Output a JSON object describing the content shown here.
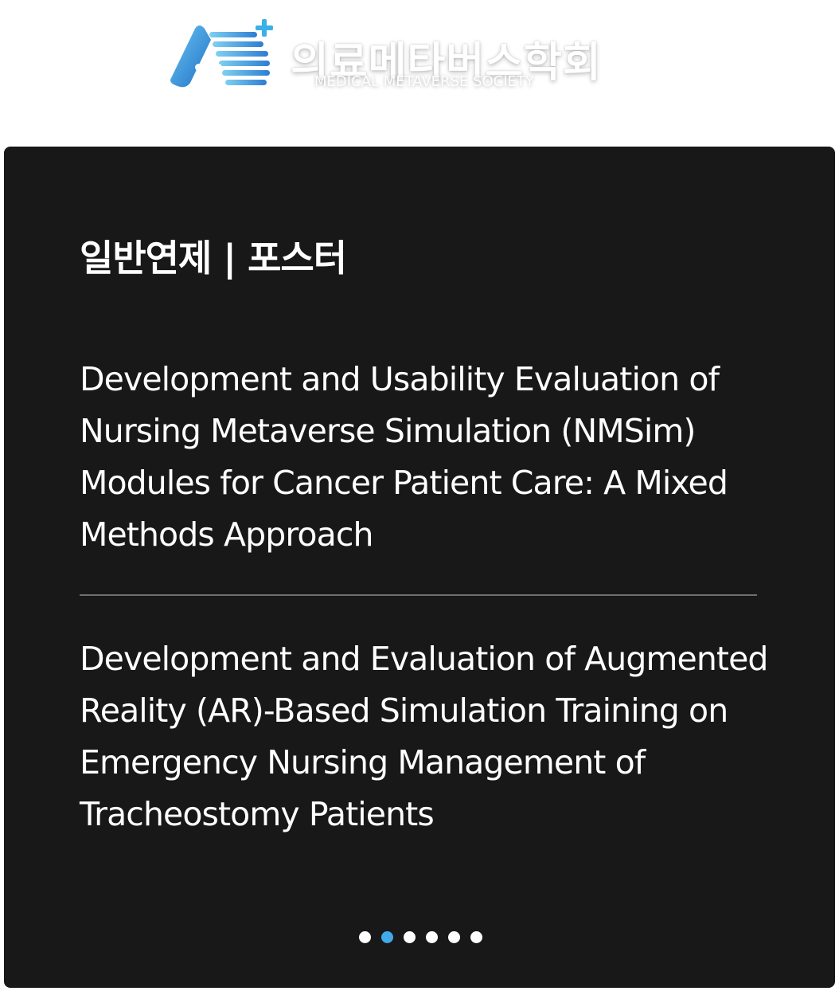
{
  "header": {
    "logo_kr": "의료메타버스학회",
    "logo_en": "MEDICAL METAVERSE SOCIETY",
    "logo_icon": "a-plus-logo-icon"
  },
  "card": {
    "title": "일반연제 | 포스터",
    "entries": [
      {
        "title": "Development and Usability Evaluation of Nursing Metaverse Simulation (NMSim) Modules for Cancer Patient Care: A Mixed Methods Approach"
      },
      {
        "title": "Development and Evaluation of Augmented Reality (AR)-Based Simulation Training on Emergency Nursing Management of Tracheostomy Patients"
      }
    ]
  },
  "pagination": {
    "total": 6,
    "active_index": 1
  },
  "colors": {
    "card_background": "#181818",
    "active_dot": "#41a9e8",
    "inactive_dot": "#ffffff",
    "divider": "#6e6e6e",
    "logo_blue": "#3a8fd8"
  }
}
